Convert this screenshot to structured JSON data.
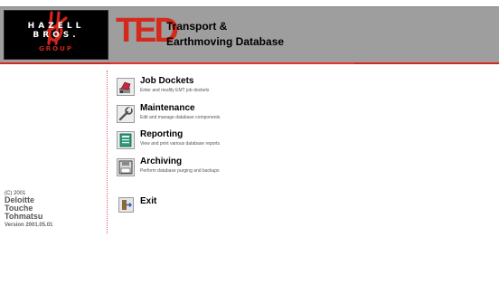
{
  "brand": {
    "company": "HAZELL BROS.",
    "group": "GROUP",
    "app_short": "TED",
    "app_title_line1": "Transport &",
    "app_title_line2": "Earthmoving Database",
    "accent": "#d42a1c"
  },
  "menu": [
    {
      "label": "Job Dockets",
      "desc": "Enter and modify EMT job dockets",
      "icon": "job-dockets-icon"
    },
    {
      "label": "Maintenance",
      "desc": "Edit and manage database components",
      "icon": "maintenance-icon"
    },
    {
      "label": "Reporting",
      "desc": "View and print various database reports",
      "icon": "reporting-icon"
    },
    {
      "label": "Archiving",
      "desc": "Perform database purging and backups",
      "icon": "archiving-icon"
    }
  ],
  "exit": {
    "label": "Exit",
    "icon": "exit-icon"
  },
  "credits": {
    "copyright": "(C) 2001",
    "firm_line1": "Deloitte",
    "firm_line2": "Touche",
    "firm_line3": "Tohmatsu",
    "version": "Version 2001.05.01"
  }
}
